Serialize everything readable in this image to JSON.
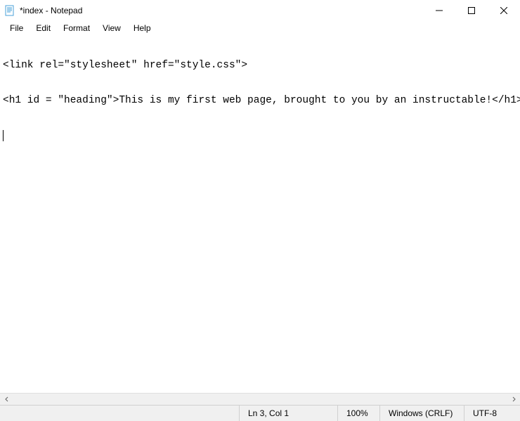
{
  "titlebar": {
    "title": "*index - Notepad"
  },
  "menu": {
    "file": "File",
    "edit": "Edit",
    "format": "Format",
    "view": "View",
    "help": "Help"
  },
  "editor": {
    "line1": "<link rel=\"stylesheet\" href=\"style.css\">",
    "line2": "<h1 id = \"heading\">This is my first web page, brought to you by an instructable!</h1>"
  },
  "statusbar": {
    "position": "Ln 3, Col 1",
    "zoom": "100%",
    "eol": "Windows (CRLF)",
    "encoding": "UTF-8"
  }
}
